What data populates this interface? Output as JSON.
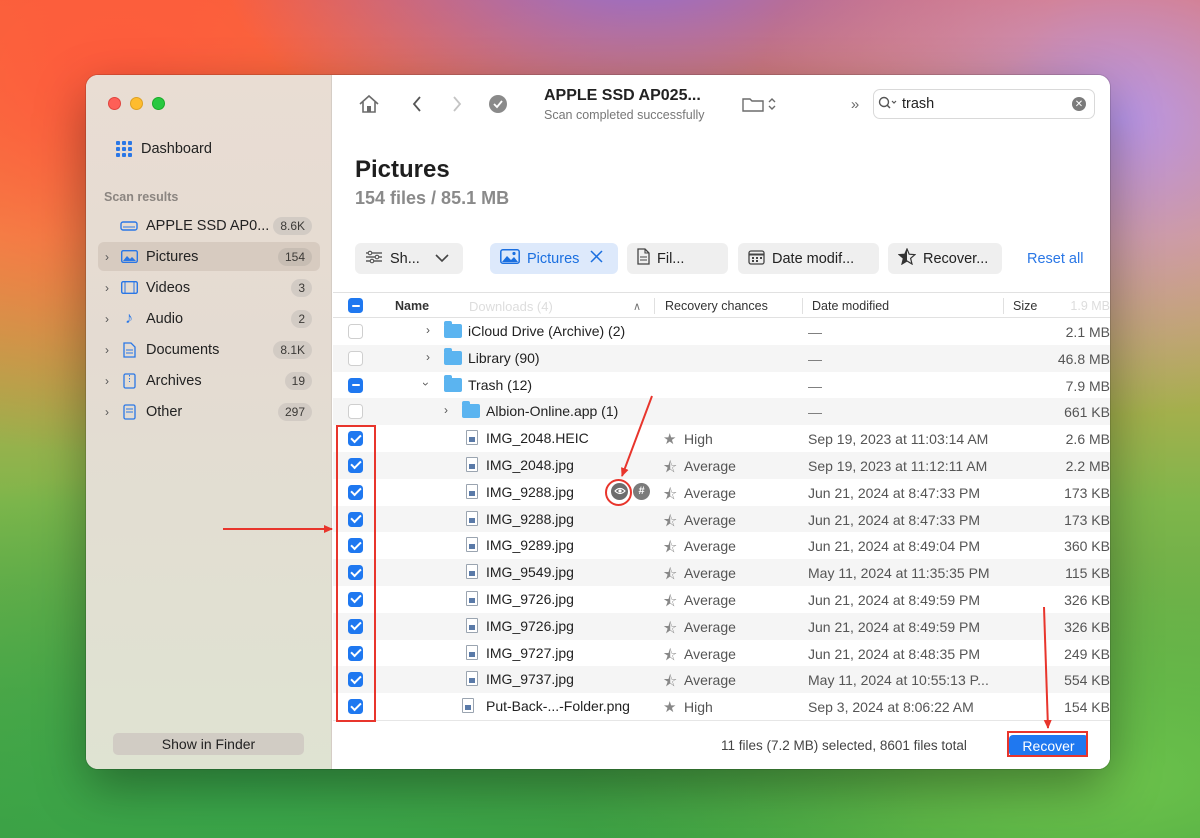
{
  "window": {
    "title": "APPLE SSD AP025...",
    "subtitle": "Scan completed successfully"
  },
  "sidebar": {
    "dashboard_label": "Dashboard",
    "section_label": "Scan results",
    "items": [
      {
        "label": "APPLE SSD AP0...",
        "count": "8.6K",
        "icon": "drive-icon"
      },
      {
        "label": "Pictures",
        "count": "154",
        "icon": "pictures-icon"
      },
      {
        "label": "Videos",
        "count": "3",
        "icon": "film-icon"
      },
      {
        "label": "Audio",
        "count": "2",
        "icon": "music-note-icon"
      },
      {
        "label": "Documents",
        "count": "8.1K",
        "icon": "document-icon"
      },
      {
        "label": "Archives",
        "count": "19",
        "icon": "archive-icon"
      },
      {
        "label": "Other",
        "count": "297",
        "icon": "file-icon"
      }
    ],
    "show_in_finder": "Show in Finder"
  },
  "search": {
    "value": "trash"
  },
  "page": {
    "title": "Pictures",
    "subtitle": "154 files / 85.1 MB"
  },
  "filters": {
    "show": "Sh...",
    "pictures": "Pictures",
    "file": "Fil...",
    "date": "Date modif...",
    "recover": "Recover...",
    "reset_all": "Reset all"
  },
  "table": {
    "ghost_header": "Downloads (4)",
    "columns": {
      "name": "Name",
      "recovery": "Recovery chances",
      "date": "Date modified",
      "size": "Size",
      "size_ghost": "1.9 MB"
    },
    "rows": [
      {
        "name": "iCloud Drive (Archive) (2)",
        "recovery": "",
        "date": "—",
        "size": "2.1 MB"
      },
      {
        "name": "Library (90)",
        "recovery": "",
        "date": "—",
        "size": "46.8 MB"
      },
      {
        "name": "Trash (12)",
        "recovery": "",
        "date": "—",
        "size": "7.9 MB"
      },
      {
        "name": "Albion-Online.app (1)",
        "recovery": "",
        "date": "—",
        "size": "661 KB"
      },
      {
        "name": "IMG_2048.HEIC",
        "recovery": "High",
        "date": "Sep 19, 2023 at 11:03:14 AM",
        "size": "2.6 MB"
      },
      {
        "name": "IMG_2048.jpg",
        "recovery": "Average",
        "date": "Sep 19, 2023 at 11:12:11 AM",
        "size": "2.2 MB"
      },
      {
        "name": "IMG_9288.jpg",
        "recovery": "Average",
        "date": "Jun 21, 2024 at 8:47:33 PM",
        "size": "173 KB"
      },
      {
        "name": "IMG_9288.jpg",
        "recovery": "Average",
        "date": "Jun 21, 2024 at 8:47:33 PM",
        "size": "173 KB"
      },
      {
        "name": "IMG_9289.jpg",
        "recovery": "Average",
        "date": "Jun 21, 2024 at 8:49:04 PM",
        "size": "360 KB"
      },
      {
        "name": "IMG_9549.jpg",
        "recovery": "Average",
        "date": "May 11, 2024 at 11:35:35 PM",
        "size": "115 KB"
      },
      {
        "name": "IMG_9726.jpg",
        "recovery": "Average",
        "date": "Jun 21, 2024 at 8:49:59 PM",
        "size": "326 KB"
      },
      {
        "name": "IMG_9726.jpg",
        "recovery": "Average",
        "date": "Jun 21, 2024 at 8:49:59 PM",
        "size": "326 KB"
      },
      {
        "name": "IMG_9727.jpg",
        "recovery": "Average",
        "date": "Jun 21, 2024 at 8:48:35 PM",
        "size": "249 KB"
      },
      {
        "name": "IMG_9737.jpg",
        "recovery": "Average",
        "date": "May 11, 2024 at 10:55:13 P...",
        "size": "554 KB"
      },
      {
        "name": "Put-Back-...-Folder.png",
        "recovery": "High",
        "date": "Sep 3, 2024 at 8:06:22 AM",
        "size": "154 KB"
      }
    ]
  },
  "footer": {
    "status": "11 files (7.2 MB) selected, 8601 files total",
    "recover_button": "Recover"
  },
  "colors": {
    "accent": "#1f78f0",
    "annotation": "#e8352c"
  }
}
